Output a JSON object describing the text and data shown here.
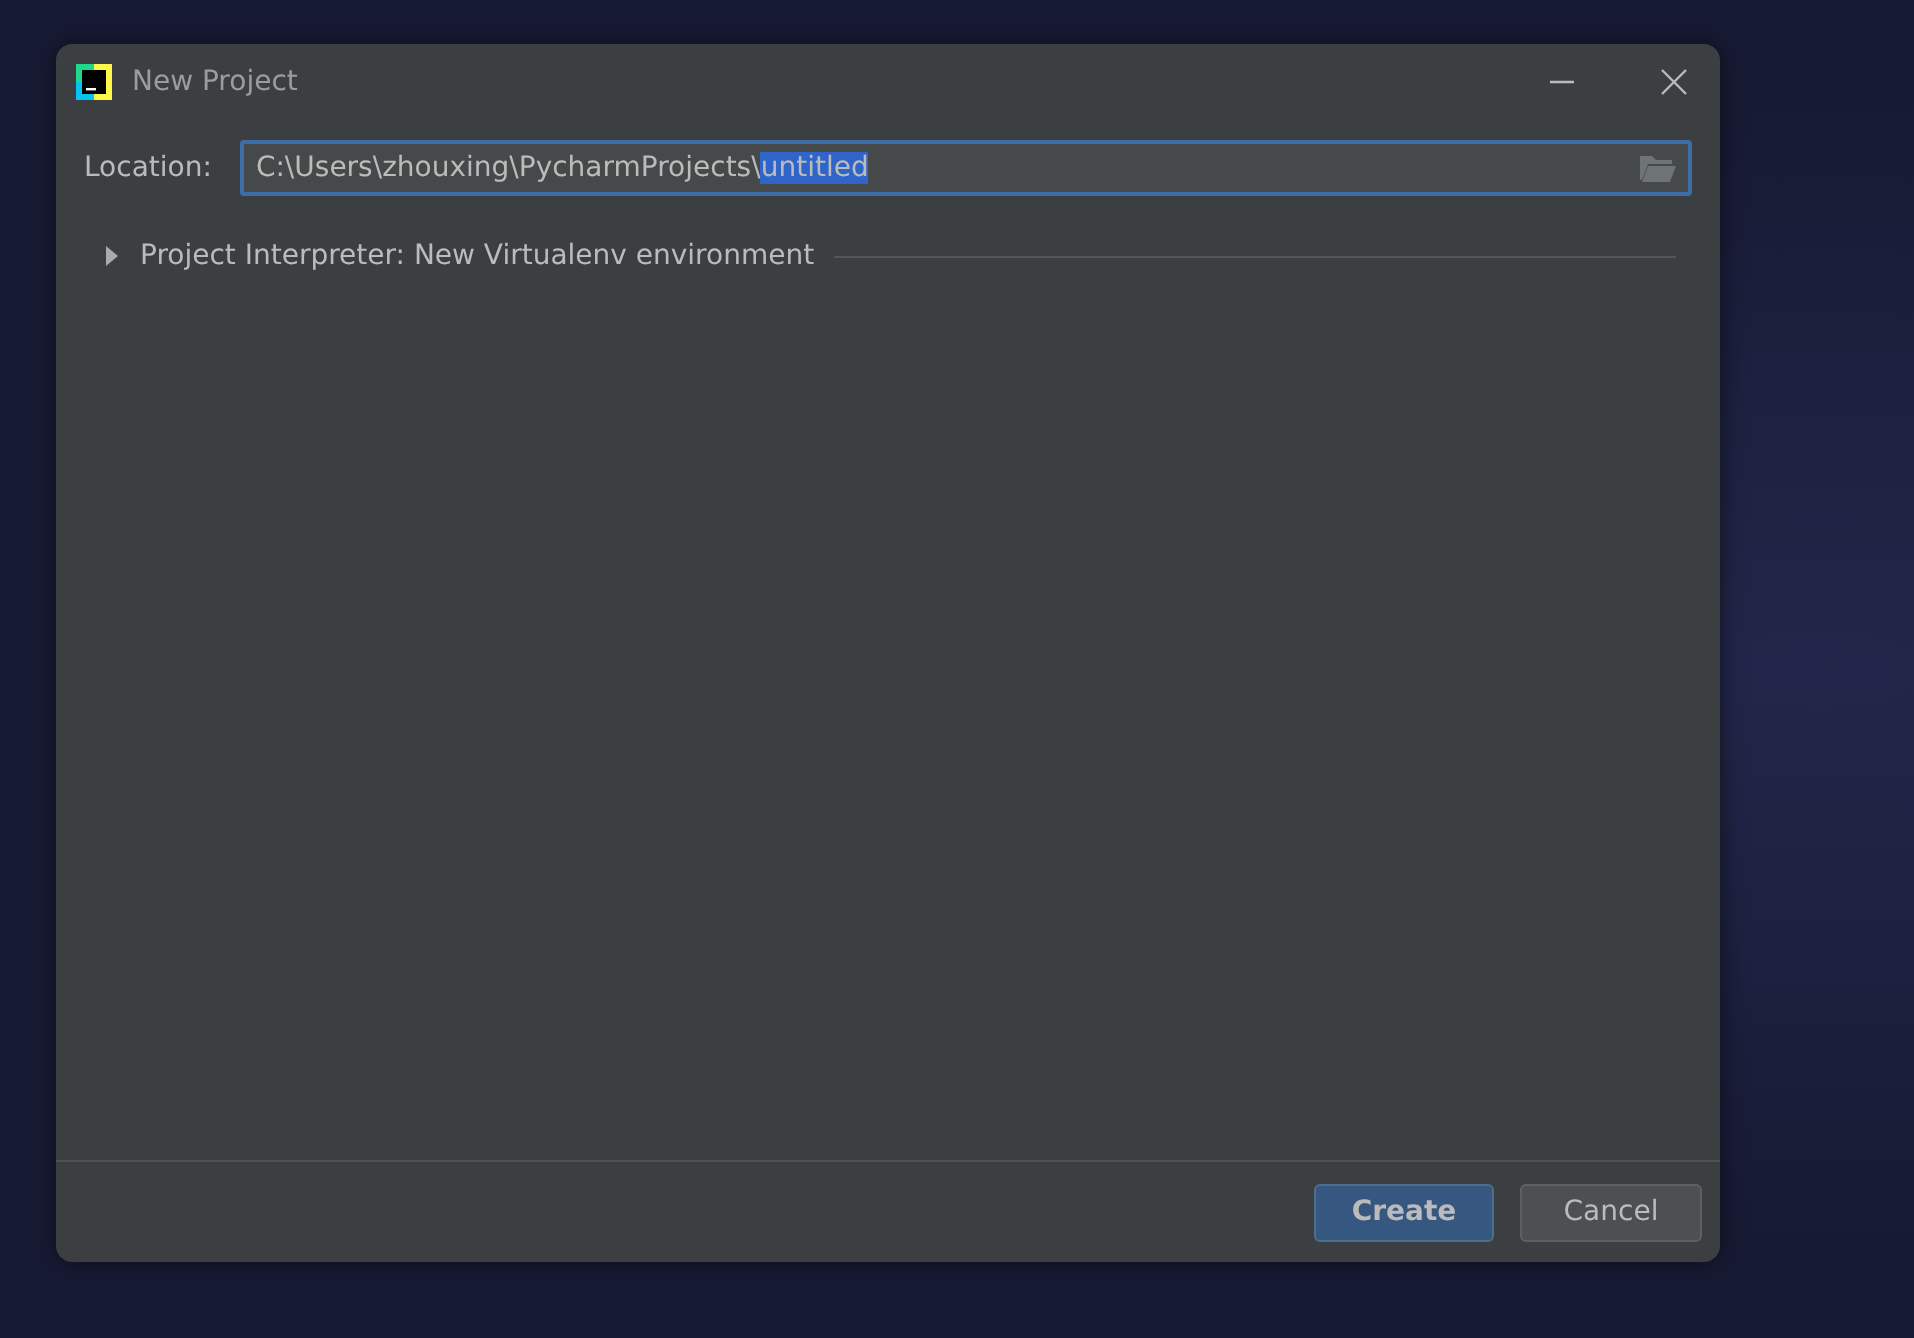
{
  "window": {
    "title": "New Project"
  },
  "location": {
    "label": "Location:",
    "path": "C:\\Users\\zhouxing\\PycharmProjects\\",
    "selected_text": "untitled"
  },
  "interpreter": {
    "label": "Project Interpreter: New Virtualenv environment",
    "expanded": false
  },
  "buttons": [
    {
      "label": "Create",
      "default": true
    },
    {
      "label": "Cancel",
      "default": false
    }
  ]
}
